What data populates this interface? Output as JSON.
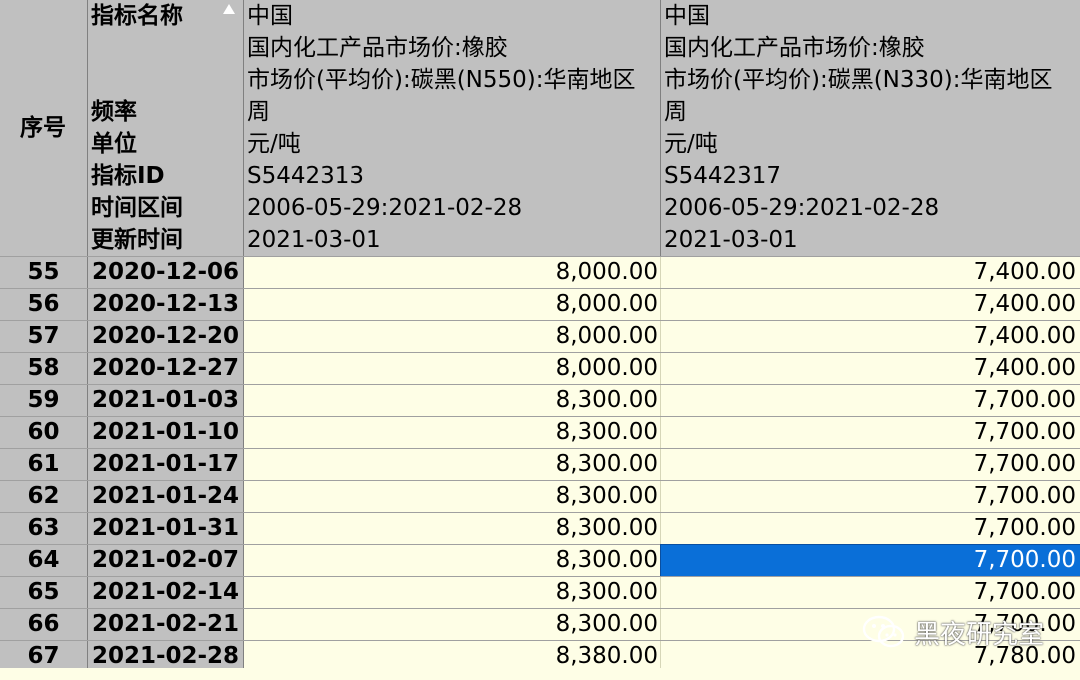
{
  "header": {
    "index_label": "序号",
    "labels": [
      "指标名称",
      "",
      "",
      "频率",
      "单位",
      "指标ID",
      "时间区间",
      "更新时间"
    ],
    "sort_icon": "sort-up-triangle",
    "columns": [
      {
        "lines": [
          "中国",
          "国内化工产品市场价:橡胶",
          "市场价(平均价):碳黑(N550):华南地区",
          "周",
          "元/吨",
          "S5442313",
          "2006-05-29:2021-02-28",
          "2021-03-01"
        ]
      },
      {
        "lines": [
          "中国",
          "国内化工产品市场价:橡胶",
          "市场价(平均价):碳黑(N330):华南地区",
          "周",
          "元/吨",
          "S5442317",
          "2006-05-29:2021-02-28",
          "2021-03-01"
        ]
      }
    ]
  },
  "rows": [
    {
      "idx": "55",
      "date": "2020-12-06",
      "v1": "8,000.00",
      "v2": "7,400.00"
    },
    {
      "idx": "56",
      "date": "2020-12-13",
      "v1": "8,000.00",
      "v2": "7,400.00"
    },
    {
      "idx": "57",
      "date": "2020-12-20",
      "v1": "8,000.00",
      "v2": "7,400.00"
    },
    {
      "idx": "58",
      "date": "2020-12-27",
      "v1": "8,000.00",
      "v2": "7,400.00"
    },
    {
      "idx": "59",
      "date": "2021-01-03",
      "v1": "8,300.00",
      "v2": "7,700.00"
    },
    {
      "idx": "60",
      "date": "2021-01-10",
      "v1": "8,300.00",
      "v2": "7,700.00"
    },
    {
      "idx": "61",
      "date": "2021-01-17",
      "v1": "8,300.00",
      "v2": "7,700.00"
    },
    {
      "idx": "62",
      "date": "2021-01-24",
      "v1": "8,300.00",
      "v2": "7,700.00"
    },
    {
      "idx": "63",
      "date": "2021-01-31",
      "v1": "8,300.00",
      "v2": "7,700.00"
    },
    {
      "idx": "64",
      "date": "2021-02-07",
      "v1": "8,300.00",
      "v2": "7,700.00",
      "selected": true
    },
    {
      "idx": "65",
      "date": "2021-02-14",
      "v1": "8,300.00",
      "v2": "7,700.00"
    },
    {
      "idx": "66",
      "date": "2021-02-21",
      "v1": "8,300.00",
      "v2": "7,700.00"
    },
    {
      "idx": "67",
      "date": "2021-02-28",
      "v1": "8,380.00",
      "v2": "7,780.00"
    }
  ],
  "watermark": {
    "text": "黑夜研究室",
    "icon": "wechat-icon"
  },
  "colors": {
    "header_bg": "#c0c0c0",
    "cell_bg": "#fefee6",
    "selection": "#0a6fd8"
  }
}
